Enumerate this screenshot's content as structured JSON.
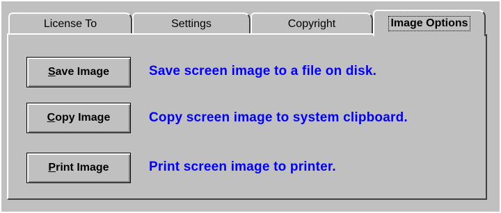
{
  "tabs": [
    {
      "label": "License To",
      "active": false
    },
    {
      "label": "Settings",
      "active": false
    },
    {
      "label": "Copyright",
      "active": false
    },
    {
      "label": "Image Options",
      "active": true
    }
  ],
  "actions": [
    {
      "button_prefix": "S",
      "button_rest": "ave Image",
      "description": "Save screen image to a file on disk."
    },
    {
      "button_prefix": "C",
      "button_rest": "opy Image",
      "description": "Copy screen image to system clipboard."
    },
    {
      "button_prefix": "P",
      "button_rest": "rint Image",
      "description": "Print screen image to printer."
    }
  ],
  "colors": {
    "background": "#c0c0c0",
    "description_text": "#0000ff"
  }
}
